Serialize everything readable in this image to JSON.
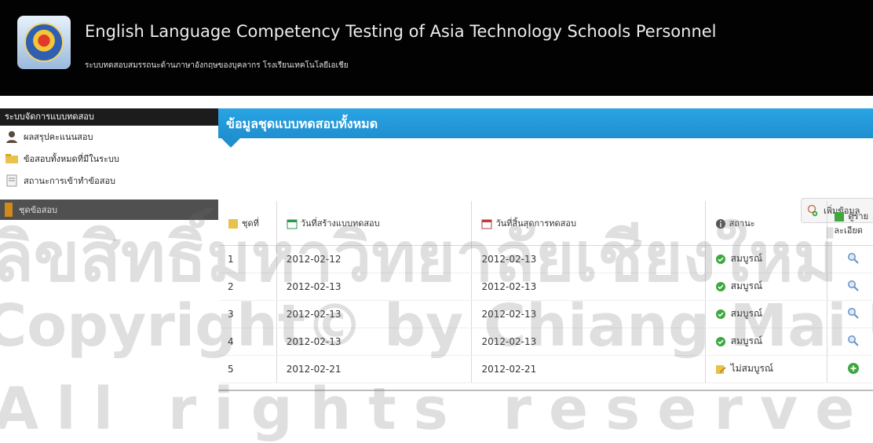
{
  "app": {
    "title": "English Language Competency Testing of Asia Technology Schools Personnel",
    "subtitle": "ระบบทดสอบสมรรถนะด้านภาษาอังกฤษของบุคลากร โรงเรียนเทคโนโลยีเอเชีย"
  },
  "sidebar": {
    "header": "ระบบจัดการแบบทดสอบ",
    "items": [
      {
        "label": "ผลสรุปคะแนนสอบ"
      },
      {
        "label": "ข้อสอบทั้งหมดที่มีในระบบ"
      },
      {
        "label": "สถานะการเข้าทำข้อสอบ"
      }
    ],
    "active_label": "ชุดข้อสอบ"
  },
  "main": {
    "title": "ข้อมูลชุดแบบทดสอบทั้งหมด",
    "add_button": "เพิ่มข้อมูล"
  },
  "table": {
    "headers": [
      "ชุดที่",
      "วันที่สร้างแบบทดสอบ",
      "วันที่สิ้นสุดการทดสอบ",
      "สถานะ",
      "ดูรายละเอียด"
    ],
    "rows": [
      {
        "no": "1",
        "created": "2012-02-12",
        "end": "2012-02-13",
        "status": "สมบูรณ์",
        "status_type": "complete",
        "action": "view"
      },
      {
        "no": "2",
        "created": "2012-02-13",
        "end": "2012-02-13",
        "status": "สมบูรณ์",
        "status_type": "complete",
        "action": "view"
      },
      {
        "no": "3",
        "created": "2012-02-13",
        "end": "2012-02-13",
        "status": "สมบูรณ์",
        "status_type": "complete",
        "action": "view"
      },
      {
        "no": "4",
        "created": "2012-02-13",
        "end": "2012-02-13",
        "status": "สมบูรณ์",
        "status_type": "complete",
        "action": "view"
      },
      {
        "no": "5",
        "created": "2012-02-21",
        "end": "2012-02-21",
        "status": "ไม่สมบูรณ์",
        "status_type": "incomplete",
        "action": "add"
      }
    ]
  },
  "watermark": {
    "line1": "ลิขสิทธิ์มหาวิทยาลัยเชียงใหม่",
    "line2": "Copyright© by Chiang Mai University",
    "line3": "All rights reserved"
  },
  "colors": {
    "header_bg": "#020202",
    "section_blue": "#1f8fd0",
    "sidebar_dark": "#1c1c1c",
    "sidebar_active": "#505050",
    "ok_green": "#3ea83e"
  }
}
